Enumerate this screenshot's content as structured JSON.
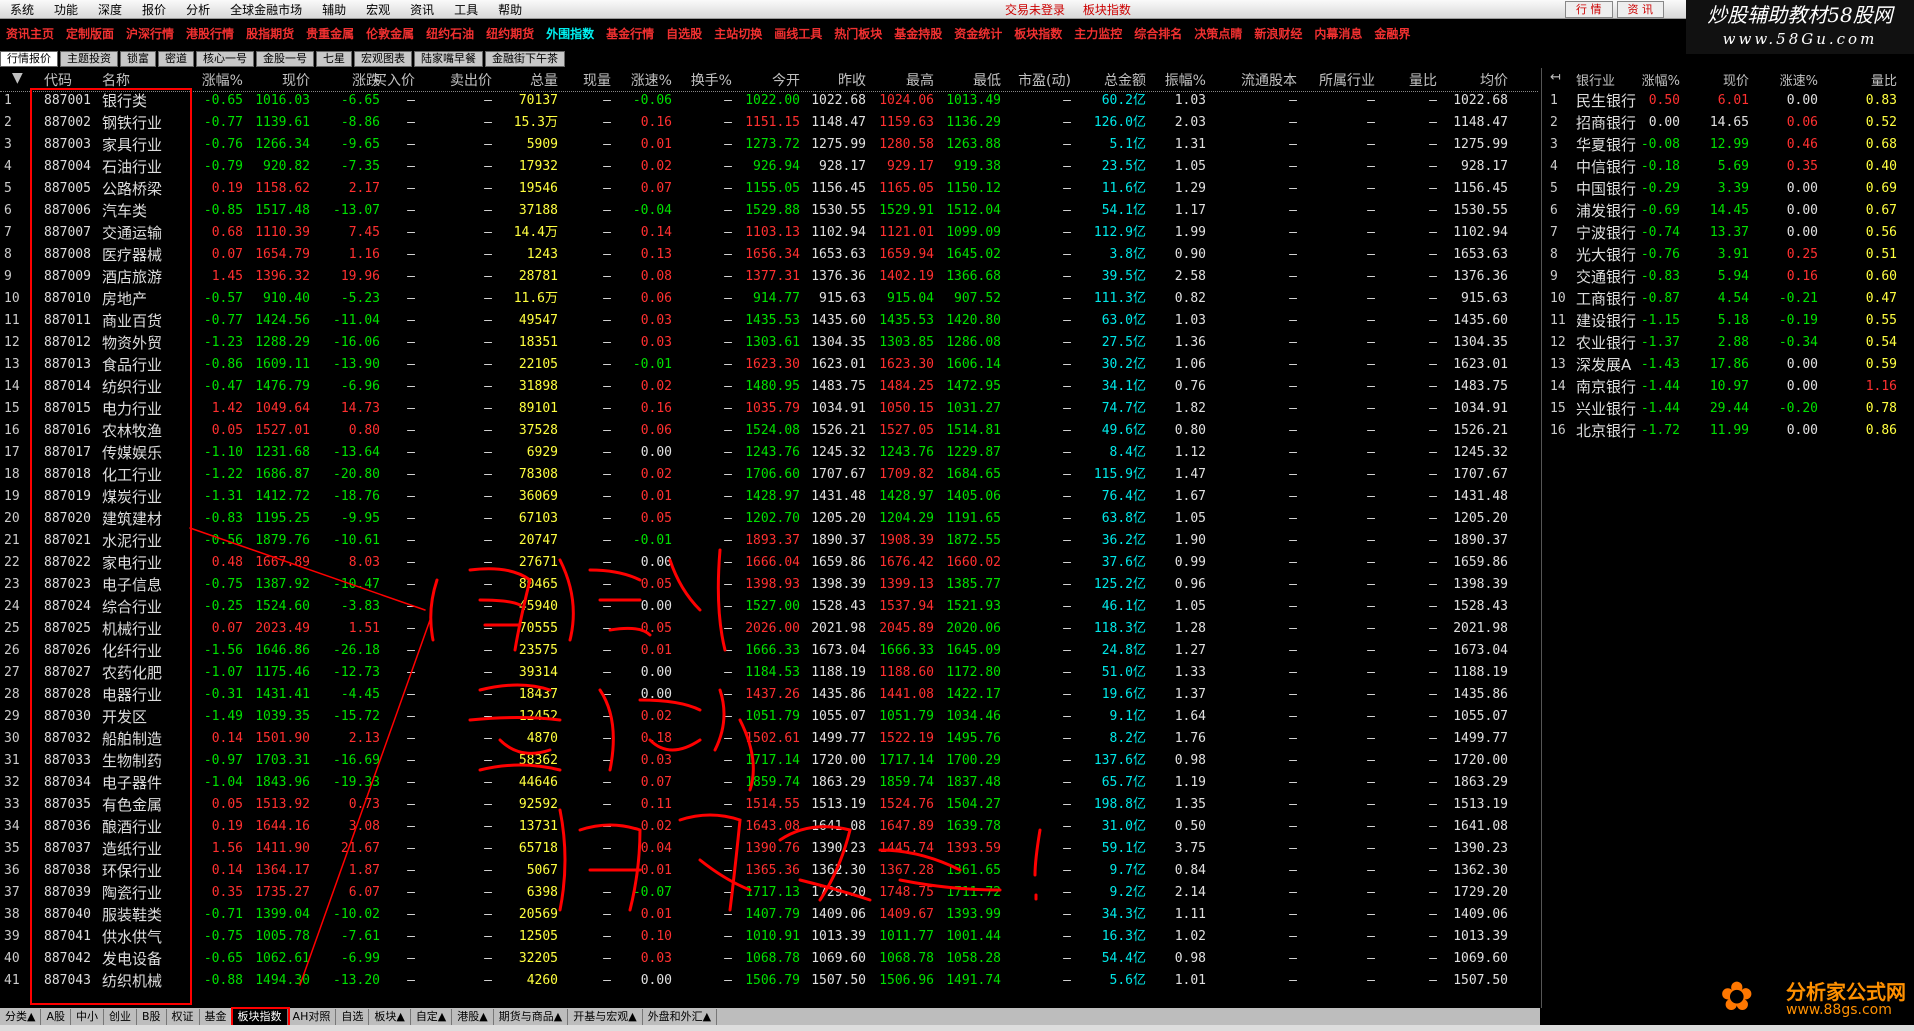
{
  "menu": [
    "系统",
    "功能",
    "深度",
    "报价",
    "分析",
    "全球金融市场",
    "辅助",
    "宏观",
    "资讯",
    "工具",
    "帮助"
  ],
  "center_status": [
    "交易未登录",
    "板块指数"
  ],
  "top_buttons": [
    "行 情",
    "资 讯"
  ],
  "brand": {
    "line1": "炒股辅助教材58股网",
    "line2": "www.58Gu.com"
  },
  "quickbar": [
    "资讯主页",
    "定制版面",
    "沪深行情",
    "港股行情",
    "股指期货",
    "贵重金属",
    "伦敦金属",
    "纽约石油",
    "纽约期货",
    "外围指数",
    "基金行情",
    "自选股",
    "主站切换",
    "画线工具",
    "热门板块",
    "基金持股",
    "资金统计",
    "板块指数",
    "主力监控",
    "综合排名",
    "决策点睛",
    "新浪财经",
    "内幕消息",
    "金融界"
  ],
  "tabs": [
    "行情报价",
    "主题投资",
    "锁富",
    "密道",
    "核心一号",
    "金股一号",
    "七星",
    "宏观图表",
    "陆家嘴早餐",
    "金融街下午茶"
  ],
  "headers": [
    "代码",
    "名称",
    "涨幅%",
    "现价",
    "涨跌",
    "买入价",
    "卖出价",
    "总量",
    "现量",
    "涨速%",
    "换手%",
    "今开",
    "昨收",
    "最高",
    "最低",
    "市盈(动)",
    "总金额",
    "振幅%",
    "流通股本",
    "所属行业",
    "量比",
    "均价"
  ],
  "dash": "—",
  "rows": [
    {
      "n": "1",
      "code": "887001",
      "name": "银行类",
      "pct": "-0.65",
      "price": "1016.03",
      "chg": "-6.65",
      "vol": "70137",
      "spd": "-0.06",
      "open": "1022.00",
      "prev": "1022.68",
      "high": "1024.06",
      "low": "1013.49",
      "amt": "60.2亿",
      "amp": "1.03",
      "avg": "1022.68"
    },
    {
      "n": "2",
      "code": "887002",
      "name": "钢铁行业",
      "pct": "-0.77",
      "price": "1139.61",
      "chg": "-8.86",
      "vol": "15.3万",
      "spd": "0.16",
      "open": "1151.15",
      "prev": "1148.47",
      "high": "1159.63",
      "low": "1136.29",
      "amt": "126.0亿",
      "amp": "2.03",
      "avg": "1148.47"
    },
    {
      "n": "3",
      "code": "887003",
      "name": "家具行业",
      "pct": "-0.76",
      "price": "1266.34",
      "chg": "-9.65",
      "vol": "5909",
      "spd": "0.01",
      "open": "1273.72",
      "prev": "1275.99",
      "high": "1280.58",
      "low": "1263.88",
      "amt": "5.1亿",
      "amp": "1.31",
      "avg": "1275.99"
    },
    {
      "n": "4",
      "code": "887004",
      "name": "石油行业",
      "pct": "-0.79",
      "price": "920.82",
      "chg": "-7.35",
      "vol": "17932",
      "spd": "0.02",
      "open": "926.94",
      "prev": "928.17",
      "high": "929.17",
      "low": "919.38",
      "amt": "23.5亿",
      "amp": "1.05",
      "avg": "928.17"
    },
    {
      "n": "5",
      "code": "887005",
      "name": "公路桥梁",
      "pct": "0.19",
      "price": "1158.62",
      "chg": "2.17",
      "vol": "19546",
      "spd": "0.07",
      "open": "1155.05",
      "prev": "1156.45",
      "high": "1165.05",
      "low": "1150.12",
      "amt": "11.6亿",
      "amp": "1.29",
      "avg": "1156.45"
    },
    {
      "n": "6",
      "code": "887006",
      "name": "汽车类",
      "pct": "-0.85",
      "price": "1517.48",
      "chg": "-13.07",
      "vol": "37188",
      "spd": "-0.04",
      "open": "1529.88",
      "prev": "1530.55",
      "high": "1529.91",
      "low": "1512.04",
      "amt": "54.1亿",
      "amp": "1.17",
      "avg": "1530.55"
    },
    {
      "n": "7",
      "code": "887007",
      "name": "交通运输",
      "pct": "0.68",
      "price": "1110.39",
      "chg": "7.45",
      "vol": "14.4万",
      "spd": "0.14",
      "open": "1103.13",
      "prev": "1102.94",
      "high": "1121.01",
      "low": "1099.09",
      "amt": "112.9亿",
      "amp": "1.99",
      "avg": "1102.94"
    },
    {
      "n": "8",
      "code": "887008",
      "name": "医疗器械",
      "pct": "0.07",
      "price": "1654.79",
      "chg": "1.16",
      "vol": "1243",
      "spd": "0.13",
      "open": "1656.34",
      "prev": "1653.63",
      "high": "1659.94",
      "low": "1645.02",
      "amt": "3.8亿",
      "amp": "0.90",
      "avg": "1653.63"
    },
    {
      "n": "9",
      "code": "887009",
      "name": "酒店旅游",
      "pct": "1.45",
      "price": "1396.32",
      "chg": "19.96",
      "vol": "28781",
      "spd": "0.08",
      "open": "1377.31",
      "prev": "1376.36",
      "high": "1402.19",
      "low": "1366.68",
      "amt": "39.5亿",
      "amp": "2.58",
      "avg": "1376.36"
    },
    {
      "n": "10",
      "code": "887010",
      "name": "房地产",
      "pct": "-0.57",
      "price": "910.40",
      "chg": "-5.23",
      "vol": "11.6万",
      "spd": "0.06",
      "open": "914.77",
      "prev": "915.63",
      "high": "915.04",
      "low": "907.52",
      "amt": "111.3亿",
      "amp": "0.82",
      "avg": "915.63"
    },
    {
      "n": "11",
      "code": "887011",
      "name": "商业百货",
      "pct": "-0.77",
      "price": "1424.56",
      "chg": "-11.04",
      "vol": "49547",
      "spd": "0.03",
      "open": "1435.53",
      "prev": "1435.60",
      "high": "1435.53",
      "low": "1420.80",
      "amt": "63.0亿",
      "amp": "1.03",
      "avg": "1435.60"
    },
    {
      "n": "12",
      "code": "887012",
      "name": "物资外贸",
      "pct": "-1.23",
      "price": "1288.29",
      "chg": "-16.06",
      "vol": "18351",
      "spd": "0.03",
      "open": "1303.61",
      "prev": "1304.35",
      "high": "1303.85",
      "low": "1286.08",
      "amt": "27.5亿",
      "amp": "1.36",
      "avg": "1304.35"
    },
    {
      "n": "13",
      "code": "887013",
      "name": "食品行业",
      "pct": "-0.86",
      "price": "1609.11",
      "chg": "-13.90",
      "vol": "22105",
      "spd": "-0.01",
      "open": "1623.30",
      "prev": "1623.01",
      "high": "1623.30",
      "low": "1606.14",
      "amt": "30.2亿",
      "amp": "1.06",
      "avg": "1623.01"
    },
    {
      "n": "14",
      "code": "887014",
      "name": "纺织行业",
      "pct": "-0.47",
      "price": "1476.79",
      "chg": "-6.96",
      "vol": "31898",
      "spd": "0.02",
      "open": "1480.95",
      "prev": "1483.75",
      "high": "1484.25",
      "low": "1472.95",
      "amt": "34.1亿",
      "amp": "0.76",
      "avg": "1483.75"
    },
    {
      "n": "15",
      "code": "887015",
      "name": "电力行业",
      "pct": "1.42",
      "price": "1049.64",
      "chg": "14.73",
      "vol": "89101",
      "spd": "0.16",
      "open": "1035.79",
      "prev": "1034.91",
      "high": "1050.15",
      "low": "1031.27",
      "amt": "74.7亿",
      "amp": "1.82",
      "avg": "1034.91"
    },
    {
      "n": "16",
      "code": "887016",
      "name": "农林牧渔",
      "pct": "0.05",
      "price": "1527.01",
      "chg": "0.80",
      "vol": "37528",
      "spd": "0.06",
      "open": "1524.08",
      "prev": "1526.21",
      "high": "1527.05",
      "low": "1514.81",
      "amt": "49.6亿",
      "amp": "0.80",
      "avg": "1526.21"
    },
    {
      "n": "17",
      "code": "887017",
      "name": "传媒娱乐",
      "pct": "-1.10",
      "price": "1231.68",
      "chg": "-13.64",
      "vol": "6929",
      "spd": "0.00",
      "open": "1243.76",
      "prev": "1245.32",
      "high": "1243.76",
      "low": "1229.87",
      "amt": "8.4亿",
      "amp": "1.12",
      "avg": "1245.32"
    },
    {
      "n": "18",
      "code": "887018",
      "name": "化工行业",
      "pct": "-1.22",
      "price": "1686.87",
      "chg": "-20.80",
      "vol": "78308",
      "spd": "0.02",
      "open": "1706.60",
      "prev": "1707.67",
      "high": "1709.82",
      "low": "1684.65",
      "amt": "115.9亿",
      "amp": "1.47",
      "avg": "1707.67"
    },
    {
      "n": "19",
      "code": "887019",
      "name": "煤炭行业",
      "pct": "-1.31",
      "price": "1412.72",
      "chg": "-18.76",
      "vol": "36069",
      "spd": "0.01",
      "open": "1428.97",
      "prev": "1431.48",
      "high": "1428.97",
      "low": "1405.06",
      "amt": "76.4亿",
      "amp": "1.67",
      "avg": "1431.48"
    },
    {
      "n": "20",
      "code": "887020",
      "name": "建筑建材",
      "pct": "-0.83",
      "price": "1195.25",
      "chg": "-9.95",
      "vol": "67103",
      "spd": "0.05",
      "open": "1202.70",
      "prev": "1205.20",
      "high": "1204.29",
      "low": "1191.65",
      "amt": "63.8亿",
      "amp": "1.05",
      "avg": "1205.20"
    },
    {
      "n": "21",
      "code": "887021",
      "name": "水泥行业",
      "pct": "-0.56",
      "price": "1879.76",
      "chg": "-10.61",
      "vol": "20747",
      "spd": "-0.01",
      "open": "1893.37",
      "prev": "1890.37",
      "high": "1908.39",
      "low": "1872.55",
      "amt": "36.2亿",
      "amp": "1.90",
      "avg": "1890.37"
    },
    {
      "n": "22",
      "code": "887022",
      "name": "家电行业",
      "pct": "0.48",
      "price": "1667.89",
      "chg": "8.03",
      "vol": "27671",
      "spd": "0.00",
      "open": "1666.04",
      "prev": "1659.86",
      "high": "1676.42",
      "low": "1660.02",
      "amt": "37.6亿",
      "amp": "0.99",
      "avg": "1659.86"
    },
    {
      "n": "23",
      "code": "887023",
      "name": "电子信息",
      "pct": "-0.75",
      "price": "1387.92",
      "chg": "-10.47",
      "vol": "80465",
      "spd": "0.05",
      "open": "1398.93",
      "prev": "1398.39",
      "high": "1399.13",
      "low": "1385.77",
      "amt": "125.2亿",
      "amp": "0.96",
      "avg": "1398.39"
    },
    {
      "n": "24",
      "code": "887024",
      "name": "综合行业",
      "pct": "-0.25",
      "price": "1524.60",
      "chg": "-3.83",
      "vol": "45940",
      "spd": "0.00",
      "open": "1527.00",
      "prev": "1528.43",
      "high": "1537.94",
      "low": "1521.93",
      "amt": "46.1亿",
      "amp": "1.05",
      "avg": "1528.43"
    },
    {
      "n": "25",
      "code": "887025",
      "name": "机械行业",
      "pct": "0.07",
      "price": "2023.49",
      "chg": "1.51",
      "vol": "70555",
      "spd": "0.05",
      "open": "2026.00",
      "prev": "2021.98",
      "high": "2045.89",
      "low": "2020.06",
      "amt": "118.3亿",
      "amp": "1.28",
      "avg": "2021.98"
    },
    {
      "n": "26",
      "code": "887026",
      "name": "化纤行业",
      "pct": "-1.56",
      "price": "1646.86",
      "chg": "-26.18",
      "vol": "23575",
      "spd": "0.01",
      "open": "1666.33",
      "prev": "1673.04",
      "high": "1666.33",
      "low": "1645.09",
      "amt": "24.8亿",
      "amp": "1.27",
      "avg": "1673.04"
    },
    {
      "n": "27",
      "code": "887027",
      "name": "农药化肥",
      "pct": "-1.07",
      "price": "1175.46",
      "chg": "-12.73",
      "vol": "39314",
      "spd": "0.00",
      "open": "1184.53",
      "prev": "1188.19",
      "high": "1188.60",
      "low": "1172.80",
      "amt": "51.0亿",
      "amp": "1.33",
      "avg": "1188.19"
    },
    {
      "n": "28",
      "code": "887028",
      "name": "电器行业",
      "pct": "-0.31",
      "price": "1431.41",
      "chg": "-4.45",
      "vol": "18437",
      "spd": "0.00",
      "open": "1437.26",
      "prev": "1435.86",
      "high": "1441.08",
      "low": "1422.17",
      "amt": "19.6亿",
      "amp": "1.37",
      "avg": "1435.86"
    },
    {
      "n": "29",
      "code": "887030",
      "name": "开发区",
      "pct": "-1.49",
      "price": "1039.35",
      "chg": "-15.72",
      "vol": "12452",
      "spd": "0.02",
      "open": "1051.79",
      "prev": "1055.07",
      "high": "1051.79",
      "low": "1034.46",
      "amt": "9.1亿",
      "amp": "1.64",
      "avg": "1055.07"
    },
    {
      "n": "30",
      "code": "887032",
      "name": "船舶制造",
      "pct": "0.14",
      "price": "1501.90",
      "chg": "2.13",
      "vol": "4870",
      "spd": "0.18",
      "open": "1502.61",
      "prev": "1499.77",
      "high": "1522.19",
      "low": "1495.76",
      "amt": "8.2亿",
      "amp": "1.76",
      "avg": "1499.77"
    },
    {
      "n": "31",
      "code": "887033",
      "name": "生物制药",
      "pct": "-0.97",
      "price": "1703.31",
      "chg": "-16.69",
      "vol": "58362",
      "spd": "0.03",
      "open": "1717.14",
      "prev": "1720.00",
      "high": "1717.14",
      "low": "1700.29",
      "amt": "137.6亿",
      "amp": "0.98",
      "avg": "1720.00"
    },
    {
      "n": "32",
      "code": "887034",
      "name": "电子器件",
      "pct": "-1.04",
      "price": "1843.96",
      "chg": "-19.33",
      "vol": "44646",
      "spd": "0.07",
      "open": "1859.74",
      "prev": "1863.29",
      "high": "1859.74",
      "low": "1837.48",
      "amt": "65.7亿",
      "amp": "1.19",
      "avg": "1863.29"
    },
    {
      "n": "33",
      "code": "887035",
      "name": "有色金属",
      "pct": "0.05",
      "price": "1513.92",
      "chg": "0.73",
      "vol": "92592",
      "spd": "0.11",
      "open": "1514.55",
      "prev": "1513.19",
      "high": "1524.76",
      "low": "1504.27",
      "amt": "198.8亿",
      "amp": "1.35",
      "avg": "1513.19"
    },
    {
      "n": "34",
      "code": "887036",
      "name": "酿酒行业",
      "pct": "0.19",
      "price": "1644.16",
      "chg": "3.08",
      "vol": "13731",
      "spd": "0.02",
      "open": "1643.08",
      "prev": "1641.08",
      "high": "1647.89",
      "low": "1639.78",
      "amt": "31.0亿",
      "amp": "0.50",
      "avg": "1641.08"
    },
    {
      "n": "35",
      "code": "887037",
      "name": "造纸行业",
      "pct": "1.56",
      "price": "1411.90",
      "chg": "21.67",
      "vol": "65718",
      "spd": "0.04",
      "open": "1390.76",
      "prev": "1390.23",
      "high": "1445.74",
      "low": "1393.59",
      "amt": "59.1亿",
      "amp": "3.75",
      "avg": "1390.23"
    },
    {
      "n": "36",
      "code": "887038",
      "name": "环保行业",
      "pct": "0.14",
      "price": "1364.17",
      "chg": "1.87",
      "vol": "5067",
      "spd": "0.01",
      "open": "1365.36",
      "prev": "1362.30",
      "high": "1367.28",
      "low": "1361.65",
      "amt": "9.7亿",
      "amp": "0.84",
      "avg": "1362.30"
    },
    {
      "n": "37",
      "code": "887039",
      "name": "陶瓷行业",
      "pct": "0.35",
      "price": "1735.27",
      "chg": "6.07",
      "vol": "6398",
      "spd": "-0.07",
      "open": "1717.13",
      "prev": "1729.20",
      "high": "1748.75",
      "low": "1711.72",
      "amt": "9.2亿",
      "amp": "2.14",
      "avg": "1729.20"
    },
    {
      "n": "38",
      "code": "887040",
      "name": "服装鞋类",
      "pct": "-0.71",
      "price": "1399.04",
      "chg": "-10.02",
      "vol": "20569",
      "spd": "0.01",
      "open": "1407.79",
      "prev": "1409.06",
      "high": "1409.67",
      "low": "1393.99",
      "amt": "34.3亿",
      "amp": "1.11",
      "avg": "1409.06"
    },
    {
      "n": "39",
      "code": "887041",
      "name": "供水供气",
      "pct": "-0.75",
      "price": "1005.78",
      "chg": "-7.61",
      "vol": "12505",
      "spd": "0.10",
      "open": "1010.91",
      "prev": "1013.39",
      "high": "1011.77",
      "low": "1001.44",
      "amt": "16.3亿",
      "amp": "1.02",
      "avg": "1013.39"
    },
    {
      "n": "40",
      "code": "887042",
      "name": "发电设备",
      "pct": "-0.65",
      "price": "1062.61",
      "chg": "-6.99",
      "vol": "32205",
      "spd": "0.03",
      "open": "1068.78",
      "prev": "1069.60",
      "high": "1068.78",
      "low": "1058.28",
      "amt": "54.4亿",
      "amp": "0.98",
      "avg": "1069.60"
    },
    {
      "n": "41",
      "code": "887043",
      "name": "纺织机械",
      "pct": "-0.88",
      "price": "1494.30",
      "chg": "-13.20",
      "vol": "4260",
      "spd": "0.00",
      "open": "1506.79",
      "prev": "1507.50",
      "high": "1506.96",
      "low": "1491.74",
      "amt": "5.6亿",
      "amp": "1.01",
      "avg": "1507.50"
    }
  ],
  "right_headers": [
    "银行业",
    "涨幅%",
    "现价",
    "涨速%",
    "量比"
  ],
  "right_rows": [
    {
      "n": "1",
      "name": "民生银行",
      "pct": "0.50",
      "price": "6.01",
      "spd": "0.00",
      "ratio": "0.83"
    },
    {
      "n": "2",
      "name": "招商银行",
      "pct": "0.00",
      "price": "14.65",
      "spd": "0.06",
      "ratio": "0.52"
    },
    {
      "n": "3",
      "name": "华夏银行",
      "pct": "-0.08",
      "price": "12.99",
      "spd": "0.46",
      "ratio": "0.68"
    },
    {
      "n": "4",
      "name": "中信银行",
      "pct": "-0.18",
      "price": "5.69",
      "spd": "0.35",
      "ratio": "0.40"
    },
    {
      "n": "5",
      "name": "中国银行",
      "pct": "-0.29",
      "price": "3.39",
      "spd": "0.00",
      "ratio": "0.69"
    },
    {
      "n": "6",
      "name": "浦发银行",
      "pct": "-0.69",
      "price": "14.45",
      "spd": "0.00",
      "ratio": "0.67"
    },
    {
      "n": "7",
      "name": "宁波银行",
      "pct": "-0.74",
      "price": "13.37",
      "spd": "0.00",
      "ratio": "0.56"
    },
    {
      "n": "8",
      "name": "光大银行",
      "pct": "-0.76",
      "price": "3.91",
      "spd": "0.25",
      "ratio": "0.51"
    },
    {
      "n": "9",
      "name": "交通银行",
      "pct": "-0.83",
      "price": "5.94",
      "spd": "0.16",
      "ratio": "0.60"
    },
    {
      "n": "10",
      "name": "工商银行",
      "pct": "-0.87",
      "price": "4.54",
      "spd": "-0.21",
      "ratio": "0.47"
    },
    {
      "n": "11",
      "name": "建设银行",
      "pct": "-1.15",
      "price": "5.18",
      "spd": "-0.19",
      "ratio": "0.55"
    },
    {
      "n": "12",
      "name": "农业银行",
      "pct": "-1.37",
      "price": "2.88",
      "spd": "-0.34",
      "ratio": "0.54"
    },
    {
      "n": "13",
      "name": "深发展A",
      "pct": "-1.43",
      "price": "17.86",
      "spd": "0.00",
      "ratio": "0.59"
    },
    {
      "n": "14",
      "name": "南京银行",
      "pct": "-1.44",
      "price": "10.97",
      "spd": "0.00",
      "ratio": "1.16"
    },
    {
      "n": "15",
      "name": "兴业银行",
      "pct": "-1.44",
      "price": "29.44",
      "spd": "-0.20",
      "ratio": "0.78"
    },
    {
      "n": "16",
      "name": "北京银行",
      "pct": "-1.72",
      "price": "11.99",
      "spd": "0.00",
      "ratio": "0.86"
    }
  ],
  "bottom_tabs": [
    "分类▲",
    "A股",
    "中小",
    "创业",
    "B股",
    "权证",
    "基金",
    "板块指数",
    "AH对照",
    "自选",
    "板块▲",
    "自定▲",
    "港股▲",
    "期货与商品▲",
    "开基与宏观▲",
    "外盘和外汇▲"
  ],
  "active_bottom_tab": "板块指数",
  "logo": {
    "t1": "分析家公式网",
    "t2": "www.88gs.com"
  },
  "colors": {
    "up": "#ff3030",
    "down": "#00e000",
    "vol": "#ffff40",
    "amt": "#00e8e8",
    "anno": "#ff0000"
  }
}
